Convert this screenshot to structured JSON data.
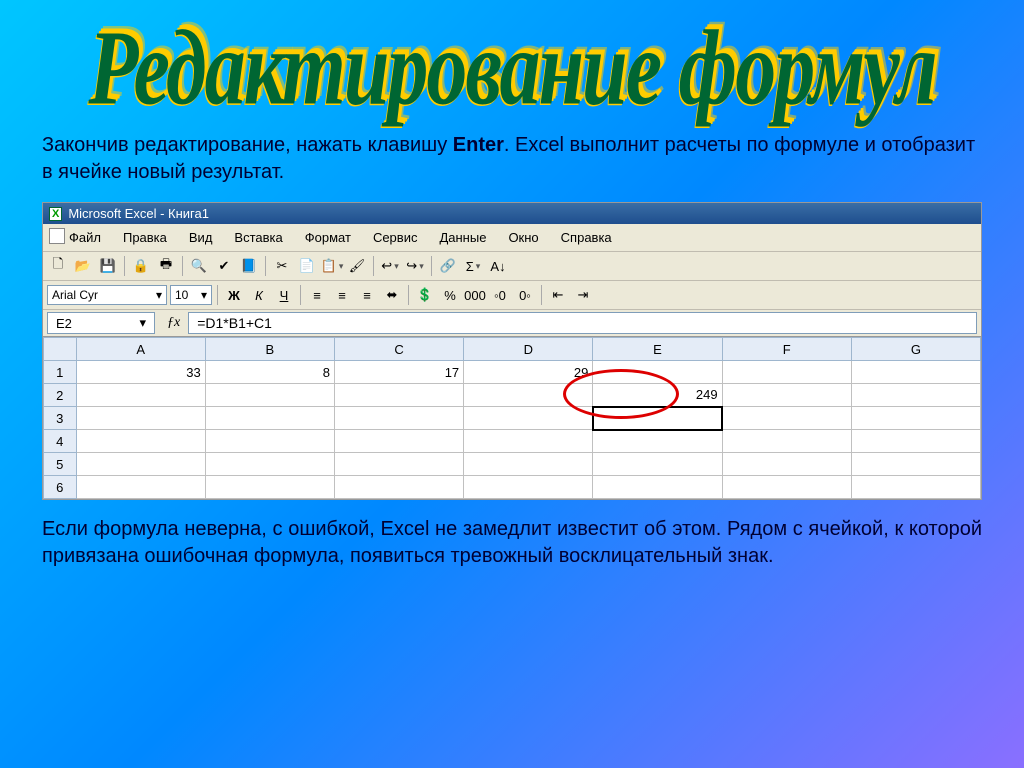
{
  "slide": {
    "title": "Редактирование формул",
    "intro_pre": "Закончив редактирование, нажать клавишу ",
    "intro_key": "Enter",
    "intro_post": ". Excel выполнит расчеты по формуле и отобразит в ячейке новый результат.",
    "outro": "Если формула неверна, с ошибкой, Excel не замедлит известит об этом. Рядом с ячейкой, к которой привязана ошибочная формула, появиться тревожный восклицательный знак."
  },
  "excel": {
    "titlebar": "Microsoft Excel - Книга1",
    "menus": [
      "Файл",
      "Правка",
      "Вид",
      "Вставка",
      "Формат",
      "Сервис",
      "Данные",
      "Окно",
      "Справка"
    ],
    "font_name": "Arial Cyr",
    "font_size": "10",
    "name_box": "E2",
    "formula": "=D1*B1+C1",
    "columns": [
      "A",
      "B",
      "C",
      "D",
      "E",
      "F",
      "G"
    ],
    "rows": [
      "1",
      "2",
      "3",
      "4",
      "5",
      "6"
    ],
    "cells": {
      "A1": "33",
      "B1": "8",
      "C1": "17",
      "D1": "29",
      "E2": "249"
    },
    "toolbar_icons": {
      "new": "🗋",
      "open": "📂",
      "save": "💾",
      "perm": "🔒",
      "print": "🖶",
      "preview": "🔍",
      "spell": "✔",
      "research": "📘",
      "cut": "✂",
      "copy": "📄",
      "paste": "📋",
      "fmt": "🖌",
      "undo": "↩",
      "redo": "↪",
      "link": "🔗",
      "sum": "Σ",
      "sort": "A↓"
    },
    "fmt_icons": {
      "bold": "Ж",
      "italic": "К",
      "under": "Ч",
      "al": "≡",
      "ac": "≡",
      "ar": "≡",
      "merge": "⬌",
      "curr": "💲",
      "pct": "%",
      "comma": "000",
      "dec1": "◦0",
      "dec2": "0◦",
      "ind1": "⇤",
      "ind2": "⇥"
    }
  }
}
